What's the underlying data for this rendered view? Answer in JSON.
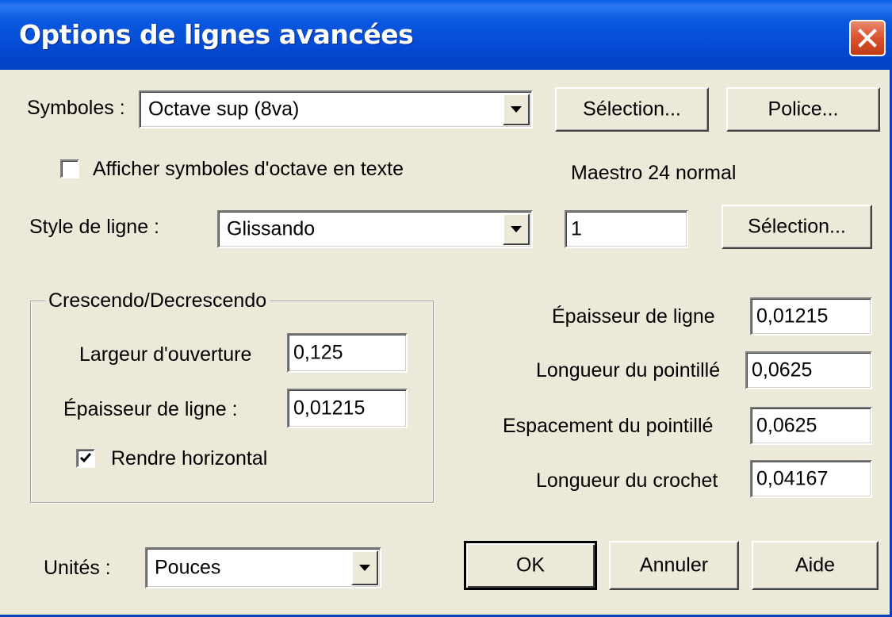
{
  "dialog": {
    "title": "Options de lignes avancées",
    "close_icon": "close-icon"
  },
  "symbols": {
    "label": "Symboles :",
    "selected": "Octave sup (8va)",
    "select_button": "Sélection...",
    "font_button": "Police..."
  },
  "octave_text": {
    "label": "Afficher symboles d'octave en texte",
    "checked": false
  },
  "font_name": "Maestro 24 normal",
  "line_style": {
    "label": "Style de ligne :",
    "selected": "Glissando",
    "value": "1",
    "select_button": "Sélection..."
  },
  "crescendo": {
    "group_title": "Crescendo/Decrescendo",
    "opening_width_label": "Largeur d'ouverture",
    "opening_width_value": "0,125",
    "line_thickness_label": "Épaisseur de ligne :",
    "line_thickness_value": "0,01215",
    "horizontal_label": "Rendre horizontal",
    "horizontal_checked": true
  },
  "line_props": {
    "thickness_label": "Épaisseur de ligne",
    "thickness_value": "0,01215",
    "dash_length_label": "Longueur du pointillé",
    "dash_length_value": "0,0625",
    "dash_spacing_label": "Espacement du pointillé",
    "dash_spacing_value": "0,0625",
    "hook_length_label": "Longueur du crochet",
    "hook_length_value": "0,04167"
  },
  "units": {
    "label": "Unités :",
    "selected": "Pouces"
  },
  "buttons": {
    "ok": "OK",
    "cancel": "Annuler",
    "help": "Aide"
  },
  "colors": {
    "titlebar": "#0449d2",
    "dialog_bg": "#ece9d8",
    "close_button": "#d9532d"
  }
}
